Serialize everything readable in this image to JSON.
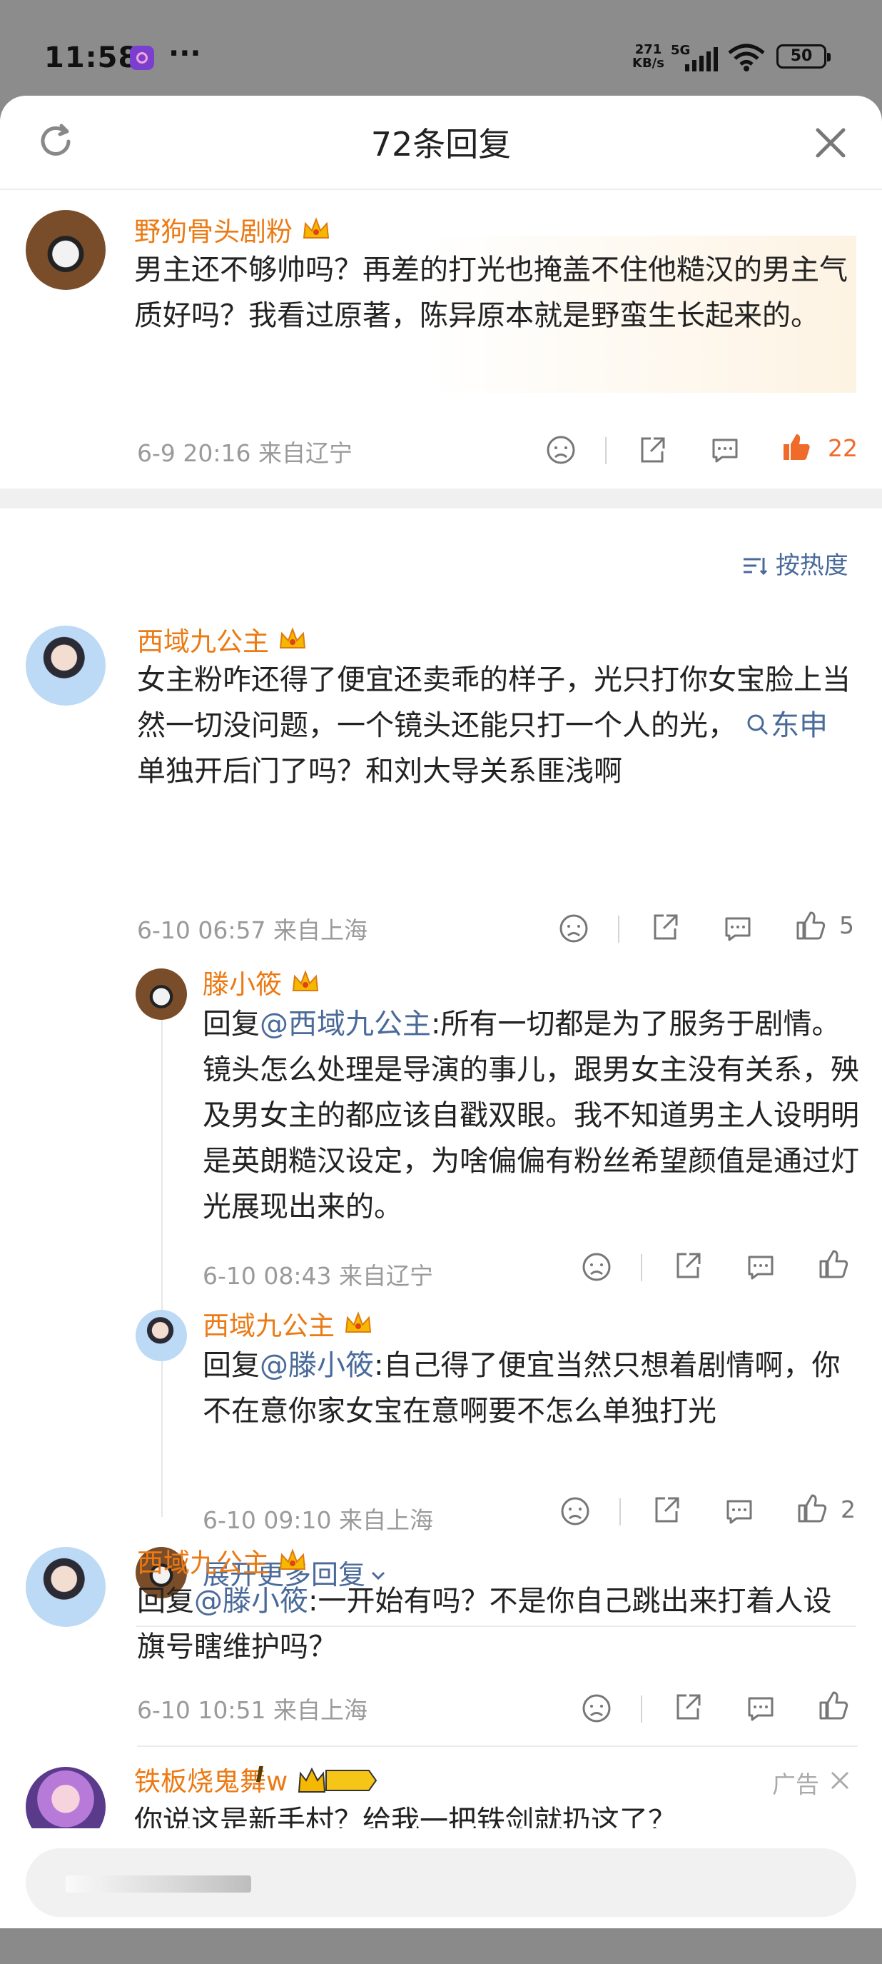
{
  "status_bar": {
    "time": "11:58",
    "dots": "···",
    "net_speed": "271\nKB/s",
    "network": "5G",
    "battery": "50"
  },
  "header": {
    "title": "72条回复"
  },
  "main_comment": {
    "username": "野狗骨头剧粉",
    "text": "男主还不够帅吗？再差的打光也掩盖不住他糙汉的男主气质好吗？我看过原著，陈异原本就是野蛮生长起来的。",
    "meta": "6-9 20:16  来自辽宁",
    "like_count": "22"
  },
  "sort": {
    "label": "按热度"
  },
  "comment1": {
    "username": "西域九公主",
    "text_before": "女主粉咋还得了便宜还卖乖的样子，光只打你女宝脸上当然一切没问题，一个镜头还能只打一个人的光，",
    "topic": "东申",
    "text_after": " 单独开后门了吗？和刘大导关系匪浅啊",
    "meta": "6-10 06:57  来自上海",
    "like_count": "5"
  },
  "reply1": {
    "username": "滕小筱",
    "reply_prefix": "回复",
    "mention": "@西域九公主",
    "text": ":所有一切都是为了服务于剧情。镜头怎么处理是导演的事儿，跟男女主没有关系，殃及男女主的都应该自戳双眼。我不知道男主人设明明是英朗糙汉设定，为啥偏偏有粉丝希望颜值是通过灯光展现出来的。",
    "meta": "6-10 08:43  来自辽宁"
  },
  "reply2": {
    "username": "西域九公主",
    "reply_prefix": "回复",
    "mention": "@滕小筱",
    "text": ":自己得了便宜当然只想着剧情啊，你不在意你家女宝在意啊要不怎么单独打光",
    "meta": "6-10 09:10  来自上海",
    "like_count": "2"
  },
  "expand": {
    "label": "展开更多回复"
  },
  "comment2": {
    "username": "西域九公主",
    "reply_prefix": "回复",
    "mention": "@滕小筱",
    "text": ":一开始有吗？不是你自己跳出来打着人设旗号瞎维护吗？",
    "meta": "6-10 10:51  来自上海"
  },
  "ad": {
    "username": "铁板烧鬼舞w",
    "level_badge": "I",
    "ad_label": "广告",
    "text": "你说这是新手村？给我一把铁剑就扔这了？"
  },
  "colors": {
    "accent_orange": "#ec7a14",
    "link_blue": "#4a6a9a",
    "like_active": "#f06a2a"
  },
  "icons": [
    "refresh-icon",
    "close-icon",
    "crown-icon",
    "dislike-icon",
    "share-icon",
    "comment-icon",
    "like-icon",
    "sort-icon",
    "search-icon",
    "chevron-down-icon"
  ]
}
